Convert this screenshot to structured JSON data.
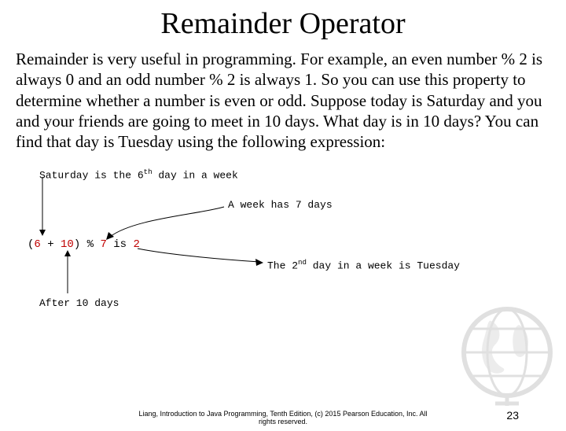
{
  "title": "Remainder Operator",
  "body": "Remainder is very useful in programming. For example, an even number % 2 is always 0 and an odd number % 2 is always 1. So you can use this property to determine whether a number is even or odd. Suppose today is Saturday and you and your friends are going to meet in 10 days. What day is in 10 days? You can find that day is Tuesday using the following expression:",
  "diagram": {
    "note_saturday": "Saturday is the 6",
    "note_saturday_sup": "th",
    "note_saturday_after": " day in a week",
    "note_week": "A week has 7 days",
    "expr_open": "(",
    "expr_six": "6",
    "expr_plus": " + ",
    "expr_ten": "10",
    "expr_close": ") % ",
    "expr_seven": "7",
    "expr_is": " is ",
    "expr_two": "2",
    "note_tuesday_pre": "The 2",
    "note_tuesday_sup": "nd",
    "note_tuesday_post": " day in a week is Tuesday",
    "note_after10": "After 10 days"
  },
  "footer_line1": "Liang, Introduction to Java Programming, Tenth Edition, (c) 2015 Pearson Education, Inc. All",
  "footer_line2": "rights reserved.",
  "page_number": "23"
}
